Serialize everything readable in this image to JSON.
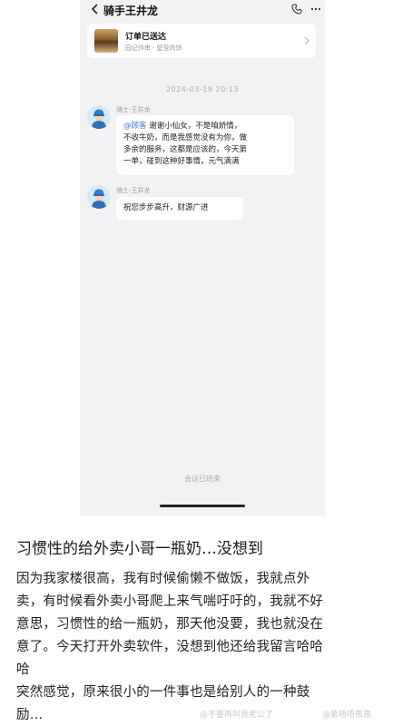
{
  "chat": {
    "title": "骑手王井龙",
    "order": {
      "status": "订单已送达",
      "subtitle": "园记作串 · 壁莹肉饼"
    },
    "timestamp": "2024-03-19 20:13",
    "messages": [
      {
        "sender": "骑士-王井龙",
        "mention": "@顾客",
        "lines": [
          "谢谢小仙女，不是咱娇情，",
          "不收牛奶，而是我感觉没有为你，做",
          "多余的服务，这都是应该的，今天第",
          "一单，碰到这种好事情，元气满满"
        ]
      },
      {
        "sender": "骑士-王井龙",
        "lines": [
          "祝您步步高升，财源广进"
        ]
      }
    ],
    "session_ended": "会话已结束"
  },
  "post": {
    "title": "习惯性的给外卖小哥一瓶奶…没想到",
    "lines": [
      "因为我家楼很高，我有时候偷懒不做饭，我就点外",
      "卖，有时候看外卖小哥爬上来气喘吁吁的，我就不好",
      "意思，习惯性的给一瓶奶，那天他没要，我也就没在",
      "意了。今天打开外卖软件，没想到他还给我留言哈哈",
      "哈",
      "突然感觉，原来很小的一件事也是给别人的一种鼓",
      "励…"
    ]
  },
  "watermarks": {
    "left": "@不要再叫我老公了",
    "right": "@紫唔唔崽崽"
  },
  "colors": {
    "chat_background": "#f2f2f4",
    "mention": "#3b7bd6",
    "bubble": "#ffffff"
  }
}
